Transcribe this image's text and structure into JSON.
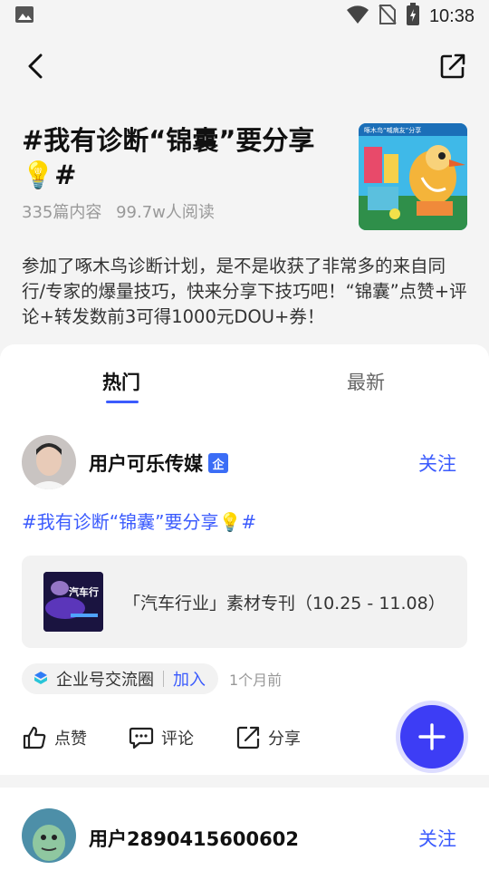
{
  "status_bar": {
    "time": "10:38"
  },
  "topic": {
    "title": "#我有诊断“锦囊”要分享💡#",
    "post_count": "335篇内容",
    "read_count": "99.7w人阅读",
    "description": "参加了啄木鸟诊断计划，是不是收获了非常多的来自同行/专家的爆量技巧，快来分享下技巧吧！“锦囊”点赞+评论+转发数前3可得1000元DOU+券！",
    "cover_text": "啄木鸟“喊病友”分享"
  },
  "tabs": [
    {
      "label": "热门",
      "active": true
    },
    {
      "label": "最新",
      "active": false
    }
  ],
  "posts": [
    {
      "author": "用户可乐传媒",
      "badge": "企",
      "follow_label": "关注",
      "topic_tag": "#我有诊断“锦囊”要分享💡#",
      "material_title": "「汽车行业」素材专刊（10.25 - 11.08）",
      "material_thumb_text": "汽车行",
      "circle_name": "企业号交流圈",
      "circle_join": "加入",
      "time": "1个月前",
      "like_label": "点赞",
      "comment_label": "评论",
      "share_label": "分享"
    },
    {
      "author": "用户2890415600602",
      "follow_label": "关注"
    }
  ],
  "colors": {
    "accent": "#3b5bfd",
    "fab": "#3d3df5"
  }
}
